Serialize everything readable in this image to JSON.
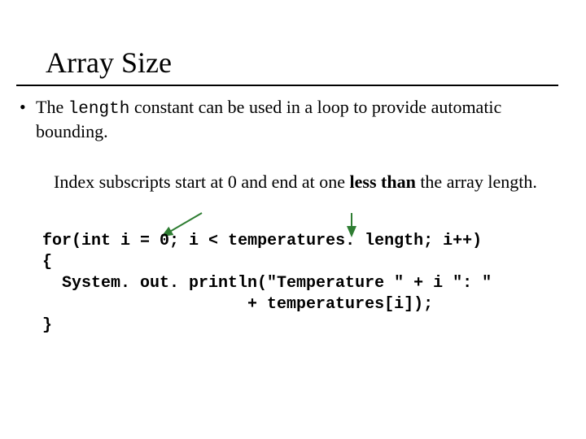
{
  "title": "Array Size",
  "bullet": {
    "pre": "The ",
    "code": "length",
    "post": " constant can be used in a loop to provide automatic bounding."
  },
  "note": {
    "pre": "Index subscripts  start at 0 and end at one ",
    "emph": "less than",
    "post": " the array length."
  },
  "code": {
    "l1a": "for(int i = 0; i ",
    "l1_lt": "<",
    "l1b": " temperatures. length; i++)",
    "l2": "{",
    "l3": "  System. out. println(\"Temperature \" + i \": \"",
    "l4": "                     + temperatures[i]);",
    "l5": "}"
  }
}
